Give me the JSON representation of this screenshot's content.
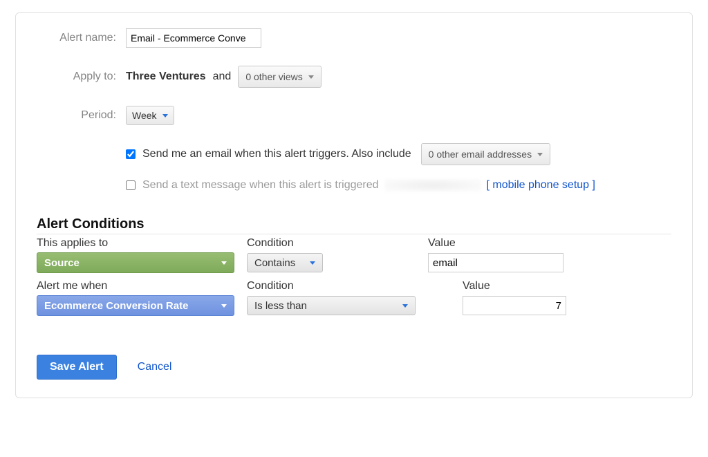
{
  "form": {
    "alert_name_label": "Alert name:",
    "alert_name_value": "Email - Ecommerce Conve",
    "apply_to_label": "Apply to:",
    "apply_to_bold": "Three Ventures",
    "apply_to_and": "and",
    "other_views_label": "0 other views",
    "period_label": "Period:",
    "period_value": "Week",
    "email_chk_checked": true,
    "email_chk_label": "Send me an email when this alert triggers. Also include",
    "other_emails_label": "0 other email addresses",
    "sms_chk_checked": false,
    "sms_chk_label": "Send a text message when this alert is triggered",
    "mobile_setup_link": "[ mobile phone setup ]"
  },
  "conditions": {
    "section_title": "Alert Conditions",
    "applies_to_header": "This applies to",
    "condition_header": "Condition",
    "value_header": "Value",
    "applies_to_value": "Source",
    "applies_condition": "Contains",
    "applies_value_input": "email",
    "alert_me_header": "Alert me when",
    "alert_metric": "Ecommerce Conversion Rate",
    "alert_condition": "Is less than",
    "alert_value_input": "7"
  },
  "buttons": {
    "save": "Save Alert",
    "cancel": "Cancel"
  }
}
